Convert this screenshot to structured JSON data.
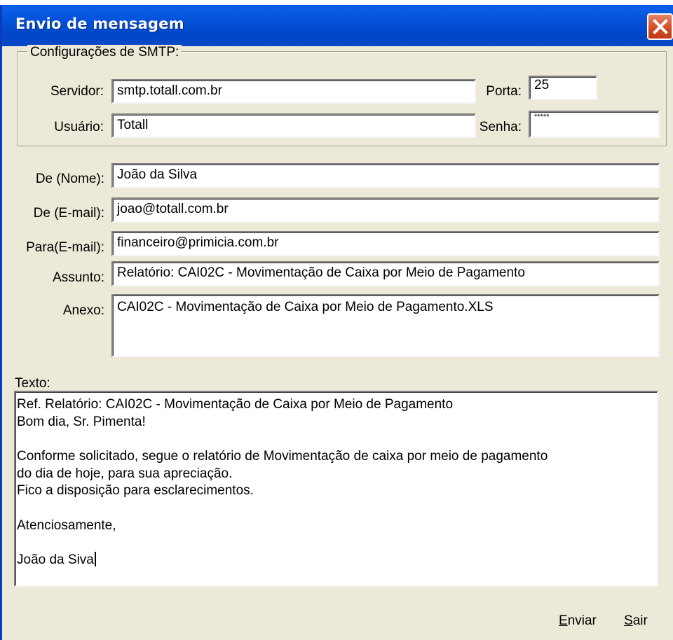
{
  "window": {
    "title": "Envio de mensagem"
  },
  "smtp": {
    "group_label": "Configurações de SMTP:",
    "server_label": "Servidor:",
    "server_value": "smtp.totall.com.br",
    "port_label": "Porta:",
    "port_value": "25",
    "user_label": "Usuário:",
    "user_value": "Totall",
    "password_label": "Senha:",
    "password_value": "*****"
  },
  "message": {
    "from_name_label": "De (Nome):",
    "from_name_value": "João da Silva",
    "from_email_label": "De (E-mail):",
    "from_email_value": "joao@totall.com.br",
    "to_label": "Para(E-mail):",
    "to_value": "financeiro@primicia.com.br",
    "subject_label": "Assunto:",
    "subject_value": "Relatório: CAI02C - Movimentação de Caixa por Meio de Pagamento",
    "attachment_label": "Anexo:",
    "attachment_value": "CAI02C - Movimentação de Caixa por Meio de Pagamento.XLS",
    "text_label": "Texto:",
    "text_lines": [
      "Ref. Relatório: CAI02C - Movimentação de Caixa por Meio de Pagamento",
      "Bom dia, Sr. Pimenta!",
      "",
      "Conforme solicitado, segue o relatório de Movimentação de caixa por meio de pagamento",
      "do dia de hoje, para sua apreciação.",
      "Fico a disposição para esclarecimentos.",
      "",
      "Atenciosamente,",
      "",
      "João da Siva"
    ]
  },
  "buttons": {
    "send_accel": "E",
    "send_rest": "nviar",
    "exit_accel": "S",
    "exit_rest": "air"
  },
  "colors": {
    "titlebar": "#0251d8",
    "close": "#d04a21",
    "face": "#ece9d8"
  },
  "icons": {
    "close": "close-icon"
  }
}
